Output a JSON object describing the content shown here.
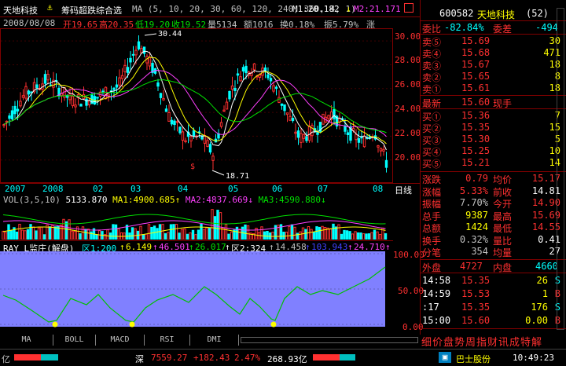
{
  "topbar": {
    "stock_name": "天地科技",
    "formula": "筹码超跌综合选",
    "ma_params": "MA (5, 10, 20, 30, 60, 120, 240, 360, 4, 1)",
    "m1": "M1:20.182",
    "m2": "M2:21.171"
  },
  "infobar": {
    "date": "2008/08/08",
    "open": "开19.65",
    "high": "高20.35",
    "low": "低19.20",
    "close": "收19.52",
    "volume": "量5134",
    "amount": "额1016",
    "turnover": "换0.18%",
    "amplitude": "振5.79%",
    "tail": "涨"
  },
  "price_chart": {
    "y_ticks": [
      "30.00",
      "28.00",
      "26.00",
      "24.00",
      "22.00",
      "20.00"
    ],
    "high_mark": "30.44",
    "low_mark": "18.71",
    "x_labels": [
      "2007",
      "2008",
      "02",
      "03",
      "04",
      "05",
      "06",
      "07",
      "08"
    ],
    "period_label": "日线",
    "colors": {
      "up": "#ff3030",
      "down": "#00ffff",
      "ma5": "#ffffff",
      "ma10": "#ffff00",
      "ma20": "#ff40ff",
      "ma30": "#00e000"
    }
  },
  "volume_chart": {
    "label": "VOL(3,5,10)",
    "value": "5133.870",
    "ma1": "MA1:4900.685",
    "ma2": "MA2:4837.669",
    "ma3": "MA3:4590.880"
  },
  "indicator_chart": {
    "name": "RAY_L监庄(解盘)",
    "zone1": "区1:200",
    "v1": "6.149",
    "v2": "46.501",
    "v3": "26.017",
    "zone2": "区2:324",
    "v4": "14.458",
    "v5": "103.943",
    "v6": "24.710",
    "y_ticks": [
      "100.00",
      "50.00",
      "0.00"
    ],
    "bg_color": "#8080ff",
    "line_color": "#00c000"
  },
  "tabs": [
    "MA",
    "BOLL",
    "MACD",
    "RSI",
    "DMI"
  ],
  "right_panel": {
    "code": "600582",
    "name": "天地科技",
    "num": "(52)",
    "wei_bi_label": "委比",
    "wei_bi": "-82.84%",
    "wei_cha_label": "委差",
    "wei_cha": "-494",
    "sell": [
      {
        "label": "卖⑤",
        "price": "15.69",
        "vol": "30"
      },
      {
        "label": "卖④",
        "price": "15.68",
        "vol": "471"
      },
      {
        "label": "卖③",
        "price": "15.67",
        "vol": "18"
      },
      {
        "label": "卖②",
        "price": "15.65",
        "vol": "8"
      },
      {
        "label": "卖①",
        "price": "15.61",
        "vol": "18"
      }
    ],
    "latest_label": "最新",
    "latest": "15.60",
    "current_hand_label": "现手",
    "buy": [
      {
        "label": "买①",
        "price": "15.36",
        "vol": "7"
      },
      {
        "label": "买②",
        "price": "15.35",
        "vol": "15"
      },
      {
        "label": "买③",
        "price": "15.30",
        "vol": "5"
      },
      {
        "label": "买④",
        "price": "15.25",
        "vol": "10"
      },
      {
        "label": "买⑤",
        "price": "15.21",
        "vol": "14"
      }
    ],
    "stats": [
      {
        "l1": "涨跌",
        "v1": "0.79",
        "l2": "均价",
        "v2": "15.17"
      },
      {
        "l1": "涨幅",
        "v1": "5.33%",
        "l2": "前收",
        "v2": "14.81"
      },
      {
        "l1": "振幅",
        "v1": "7.70%",
        "l2": "今开",
        "v2": "14.90"
      },
      {
        "l1": "总手",
        "v1": "9387",
        "l2": "最高",
        "v2": "15.69"
      },
      {
        "l1": "总额",
        "v1": "1424",
        "l2": "最低",
        "v2": "14.55"
      },
      {
        "l1": "换手",
        "v1": "0.32%",
        "l2": "量比",
        "v2": "0.41"
      },
      {
        "l1": "分笔",
        "v1": "354",
        "l2": "均量",
        "v2": "27"
      }
    ],
    "outer_label": "外盘",
    "outer": "4727",
    "inner_label": "内盘",
    "inner": "4660",
    "ticks": [
      {
        "time": "14:58",
        "price": "15.35",
        "vol": "26",
        "flag": "S"
      },
      {
        "time": "14:59",
        "price": "15.53",
        "vol": "1",
        "flag": "B"
      },
      {
        "time": ":17",
        "price": "15.35",
        "vol": "176",
        "flag": "S"
      },
      {
        "time": "15:00",
        "price": "15.60",
        "vol": "0.00",
        "flag": "B"
      }
    ],
    "menu": "细价盘势周指财讯成特解"
  },
  "statusbar": {
    "left_unit": "亿",
    "market": "深",
    "index": "7559.27",
    "change": "+182.43",
    "pct": "2.47%",
    "amount": "268.93亿",
    "news": "巴士股份",
    "time": "10:49:23"
  }
}
